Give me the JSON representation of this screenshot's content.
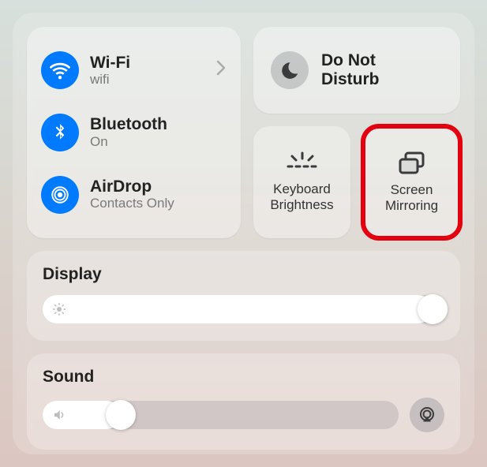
{
  "connectivity": {
    "wifi": {
      "title": "Wi-Fi",
      "subtitle": "wifi"
    },
    "bluetooth": {
      "title": "Bluetooth",
      "subtitle": "On"
    },
    "airdrop": {
      "title": "AirDrop",
      "subtitle": "Contacts Only"
    }
  },
  "dnd": {
    "title": "Do Not\nDisturb"
  },
  "tiles": {
    "keyboard_brightness": "Keyboard Brightness",
    "screen_mirroring": "Screen Mirroring"
  },
  "display": {
    "title": "Display",
    "value_percent": 97
  },
  "sound": {
    "title": "Sound",
    "value_percent": 22
  }
}
